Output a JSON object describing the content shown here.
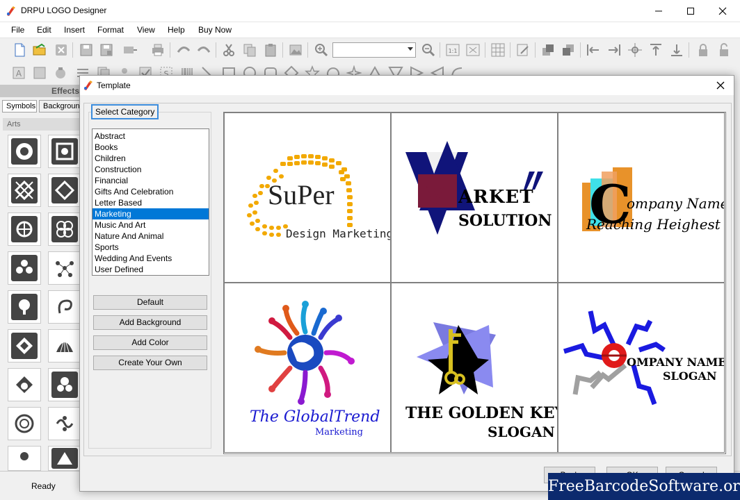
{
  "app": {
    "title": "DRPU LOGO Designer"
  },
  "menu": {
    "items": [
      "File",
      "Edit",
      "Insert",
      "Format",
      "View",
      "Help",
      "Buy Now"
    ]
  },
  "left_panel": {
    "effects_header": "Effects",
    "tabs": [
      "Symbols",
      "Backgrounds"
    ],
    "arts_label": "Arts"
  },
  "status": {
    "text": "Ready"
  },
  "dialog": {
    "title": "Template",
    "category_group_label": "Select Category",
    "categories": [
      "Abstract",
      "Books",
      "Children",
      "Construction",
      "Financial",
      "Gifts And Celebration",
      "Letter Based",
      "Marketing",
      "Music And Art",
      "Nature And Animal",
      "Sports",
      "Wedding And Events",
      "User Defined"
    ],
    "selected_category": "Marketing",
    "buttons": [
      "Default",
      "Add Background",
      "Add Color",
      "Create Your Own"
    ],
    "footer_buttons": [
      "Back",
      "OK",
      "Cancel"
    ],
    "templates": [
      {
        "line1": "SuPer",
        "line2": "Design Marketing"
      },
      {
        "line1": "ARKET",
        "line2": "SOLUTION"
      },
      {
        "line1": "ompany Name",
        "line2": "Reaching Heighest"
      },
      {
        "line1": "The GlobalTrend",
        "line2": "Marketing"
      },
      {
        "line1": "THE GOLDEN KEY",
        "line2": "SLOGAN"
      },
      {
        "line1": "OMPANY NAME",
        "line2": "SLOGAN"
      }
    ]
  },
  "watermark": "FreeBarcodeSoftware.org",
  "colors": {
    "selection": "#0078d7",
    "focus_border": "#3c8cdc",
    "watermark_bg": "#0c2a6e"
  }
}
